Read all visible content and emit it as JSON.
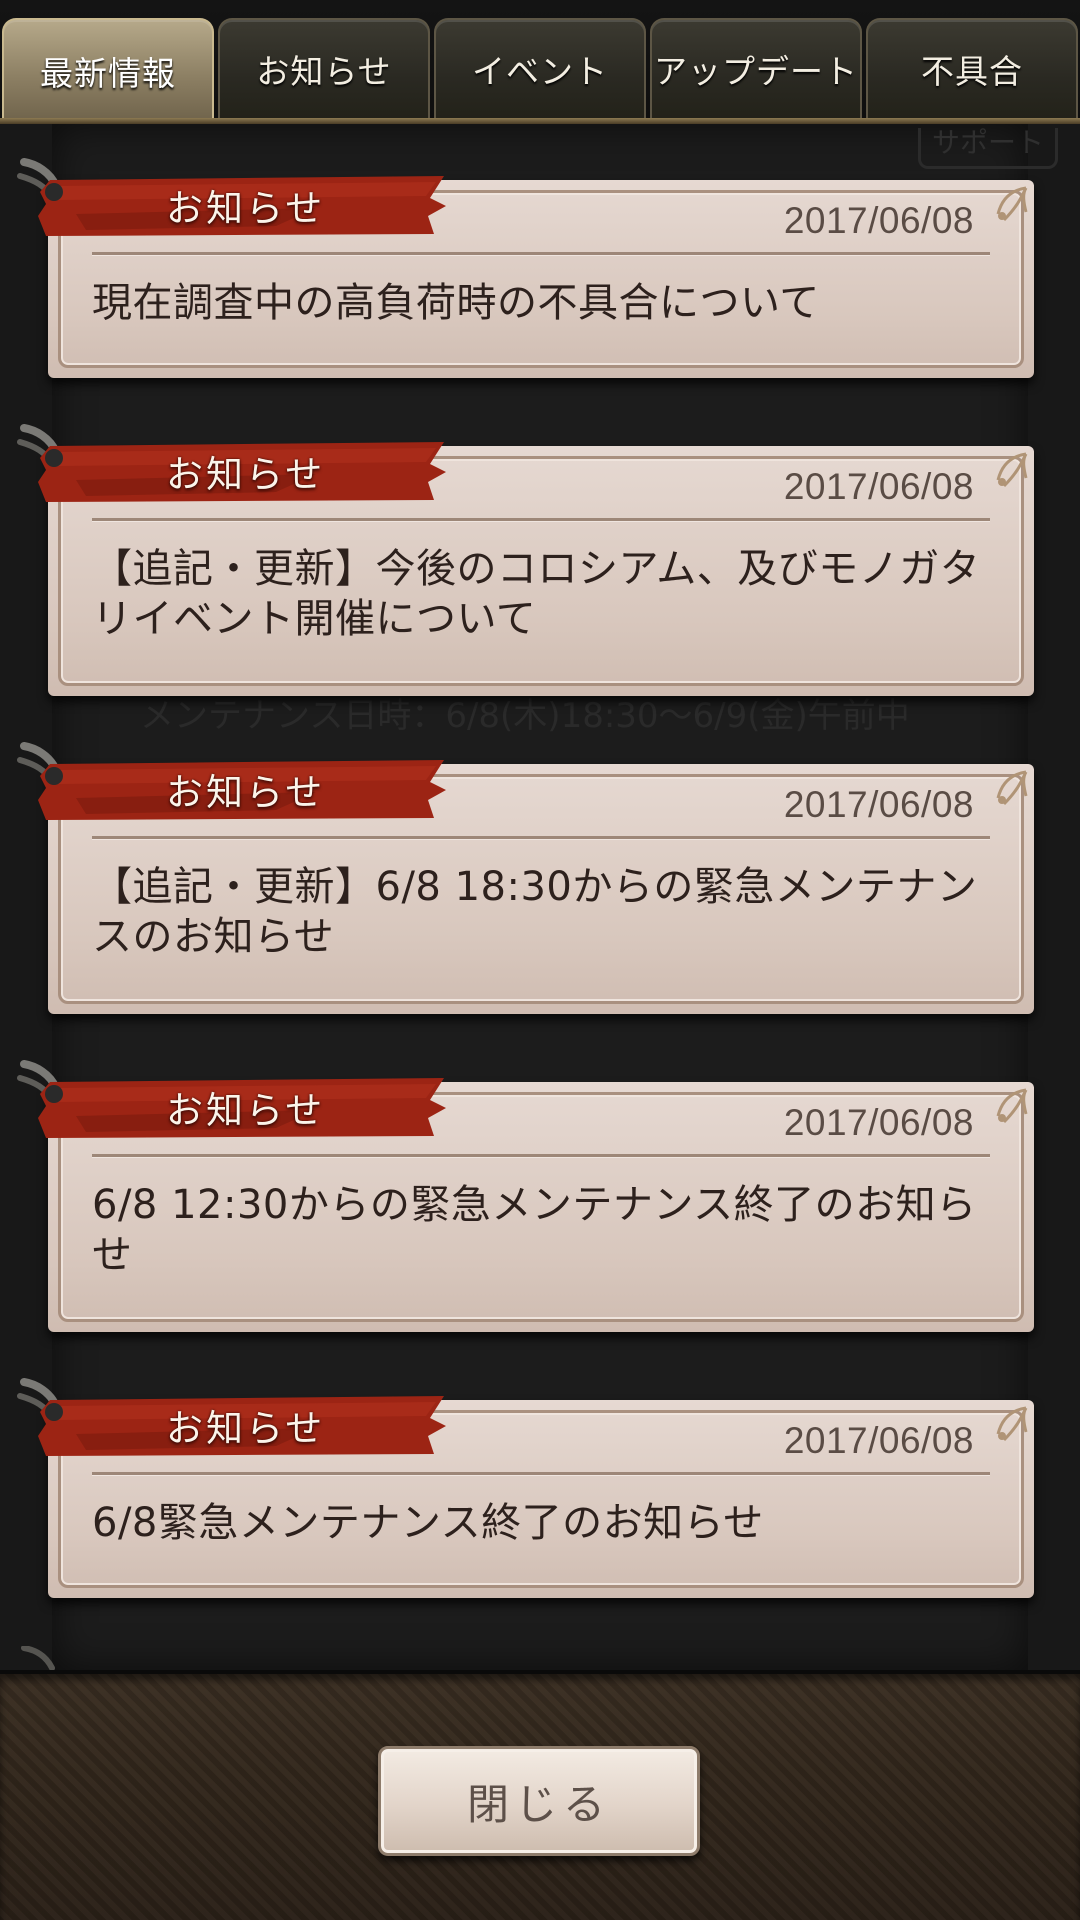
{
  "tabs": [
    {
      "label": "最新情報",
      "active": true
    },
    {
      "label": "お知らせ",
      "active": false
    },
    {
      "label": "イベント",
      "active": false
    },
    {
      "label": "アップデート",
      "active": false
    },
    {
      "label": "不具合",
      "active": false
    }
  ],
  "background_ghost": {
    "support_label": "サポート",
    "maintenance_line": "メンテナンス日時：6/8(木)18:30〜6/9(金)午前中"
  },
  "notices": [
    {
      "category": "お知らせ",
      "date": "2017/06/08",
      "title": "現在調査中の高負荷時の不具合について"
    },
    {
      "category": "お知らせ",
      "date": "2017/06/08",
      "title": "【追記・更新】今後のコロシアム、及びモノガタリイベント開催について"
    },
    {
      "category": "お知らせ",
      "date": "2017/06/08",
      "title": "【追記・更新】6/8 18:30からの緊急メンテナンスのお知らせ"
    },
    {
      "category": "お知らせ",
      "date": "2017/06/08",
      "title": "6/8 12:30からの緊急メンテナンス終了のお知らせ"
    },
    {
      "category": "お知らせ",
      "date": "2017/06/08",
      "title": "6/8緊急メンテナンス終了のお知らせ"
    }
  ],
  "footer": {
    "close_label": "閉じる"
  },
  "colors": {
    "ribbon_red": "#9c2414",
    "card_bg": "#e2d4cc",
    "active_tab": "#9a8d70"
  }
}
